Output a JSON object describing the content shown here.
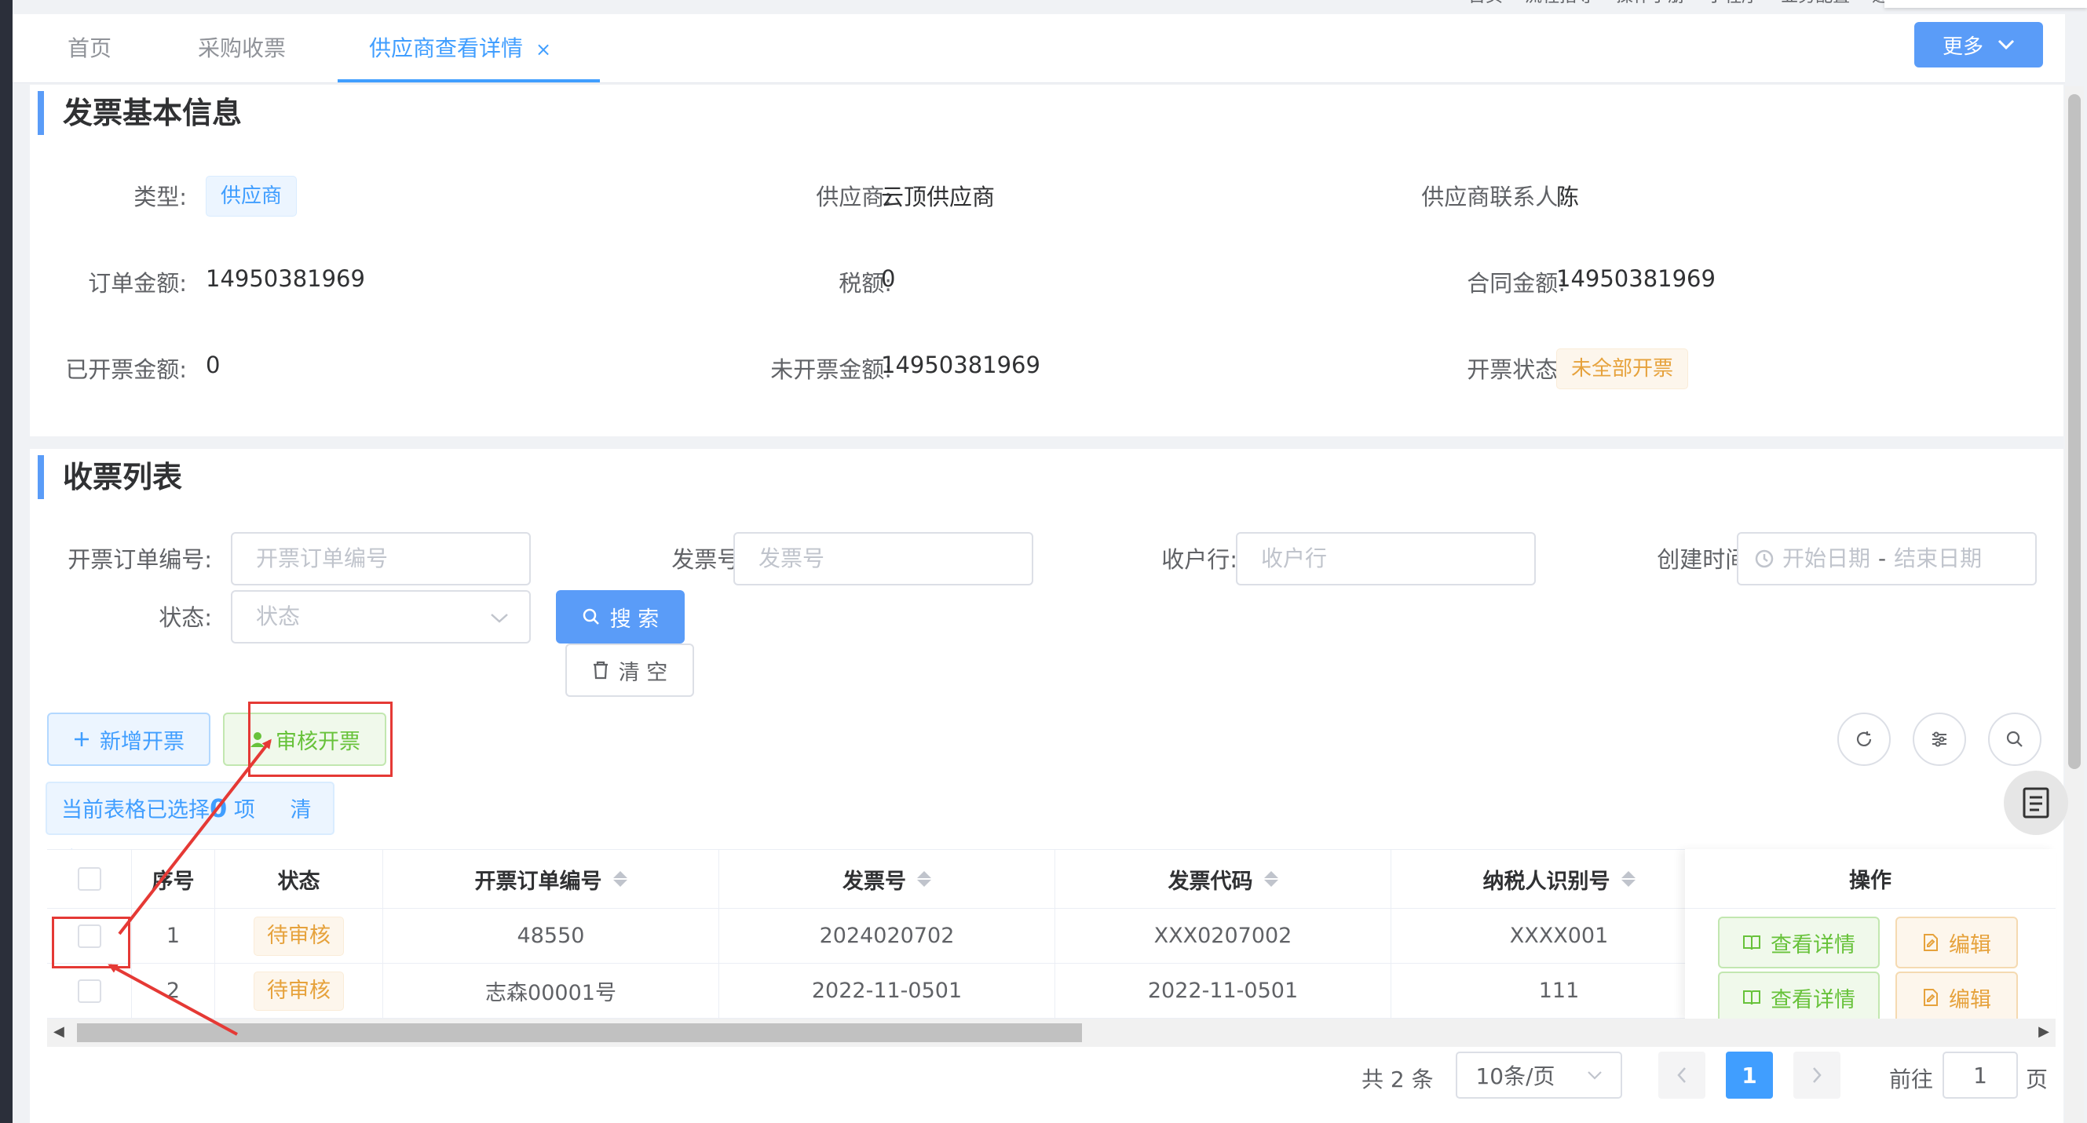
{
  "top_links": [
    "首页",
    "流程指导",
    "操作手册",
    "小程序",
    "业务配置",
    "通知"
  ],
  "tabs": [
    {
      "label": "首页"
    },
    {
      "label": "采购收票"
    },
    {
      "label": "供应商查看详情",
      "close": "×"
    }
  ],
  "more_button": "更多",
  "invoice_info": {
    "title": "发票基本信息",
    "type_label": "类型:",
    "type_value": "供应商",
    "supplier_label": "供应商:",
    "supplier_value": "云顶供应商",
    "contact_label": "供应商联系人:",
    "contact_value": "陈",
    "order_amount_label": "订单金额:",
    "order_amount_value": "14950381969",
    "tax_label": "税额:",
    "tax_value": "0",
    "contract_amount_label": "合同金额:",
    "contract_amount_value": "14950381969",
    "invoiced_label": "已开票金额:",
    "invoiced_value": "0",
    "uninvoiced_label": "未开票金额:",
    "uninvoiced_value": "14950381969",
    "status_label": "开票状态:",
    "status_value": "未全部开票"
  },
  "receipt_list": {
    "title": "收票列表",
    "filters": {
      "order_no_label": "开票订单编号:",
      "order_no_placeholder": "开票订单编号",
      "invoice_no_label": "发票号:",
      "invoice_no_placeholder": "发票号",
      "bank_label": "收户行:",
      "bank_placeholder": "收户行",
      "created_label": "创建时间:",
      "date_start": "开始日期",
      "date_sep": "-",
      "date_end": "结束日期",
      "status_label": "状态:",
      "status_placeholder": "状态"
    },
    "search_button": "搜 索",
    "clear_button": "清 空",
    "add_button": "新增开票",
    "audit_button": "审核开票",
    "selection": {
      "prefix": "当前表格已选择",
      "count": "0",
      "suffix": "项",
      "clear": "清 空"
    },
    "columns": [
      "序号",
      "状态",
      "开票订单编号",
      "发票号",
      "发票代码",
      "纳税人识别号",
      "操作"
    ],
    "rows": [
      {
        "index": "1",
        "status": "待审核",
        "order_no": "48550",
        "invoice_no": "2024020702",
        "invoice_code": "XXX0207002",
        "taxpayer_id": "XXXX001"
      },
      {
        "index": "2",
        "status": "待审核",
        "order_no": "志森00001号",
        "invoice_no": "2022-11-0501",
        "invoice_code": "2022-11-0501",
        "taxpayer_id": "111"
      }
    ],
    "row_actions": {
      "view": "查看详情",
      "edit": "编辑"
    }
  },
  "pagination": {
    "total_text": "共 2 条",
    "page_size": "10条/页",
    "current_page": "1",
    "goto_label": "前往",
    "goto_value": "1",
    "page_unit": "页"
  },
  "colors": {
    "primary": "#409eff",
    "success": "#67c23a",
    "warning": "#e6a23c",
    "annotation": "#e53935"
  }
}
